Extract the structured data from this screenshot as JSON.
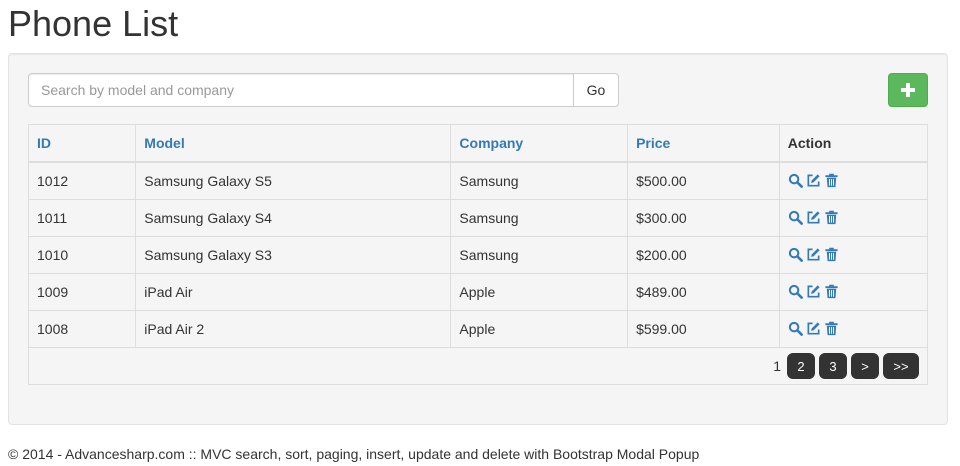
{
  "page": {
    "title": "Phone List"
  },
  "search": {
    "placeholder": "Search by model and company",
    "value": "",
    "go_label": "Go"
  },
  "add": {
    "icon": "plus-icon"
  },
  "table": {
    "headers": {
      "id": "ID",
      "model": "Model",
      "company": "Company",
      "price": "Price",
      "action": "Action"
    },
    "rows": [
      {
        "id": "1012",
        "model": "Samsung Galaxy S5",
        "company": "Samsung",
        "price": "$500.00"
      },
      {
        "id": "1011",
        "model": "Samsung Galaxy S4",
        "company": "Samsung",
        "price": "$300.00"
      },
      {
        "id": "1010",
        "model": "Samsung Galaxy S3",
        "company": "Samsung",
        "price": "$200.00"
      },
      {
        "id": "1009",
        "model": "iPad Air",
        "company": "Apple",
        "price": "$489.00"
      },
      {
        "id": "1008",
        "model": "iPad Air 2",
        "company": "Apple",
        "price": "$599.00"
      }
    ],
    "action_icons": [
      "search-icon",
      "edit-icon",
      "trash-icon"
    ]
  },
  "pager": {
    "current": "1",
    "pages": [
      "2",
      "3"
    ],
    "next": ">",
    "last": ">>"
  },
  "footer": {
    "text": "© 2014 - Advancesharp.com :: MVC search, sort, paging, insert, update and delete with Bootstrap Modal Popup"
  },
  "colors": {
    "link": "#337ab7",
    "success": "#5cb85c",
    "pager_bg": "#333333",
    "panel_bg": "#f5f5f5"
  }
}
